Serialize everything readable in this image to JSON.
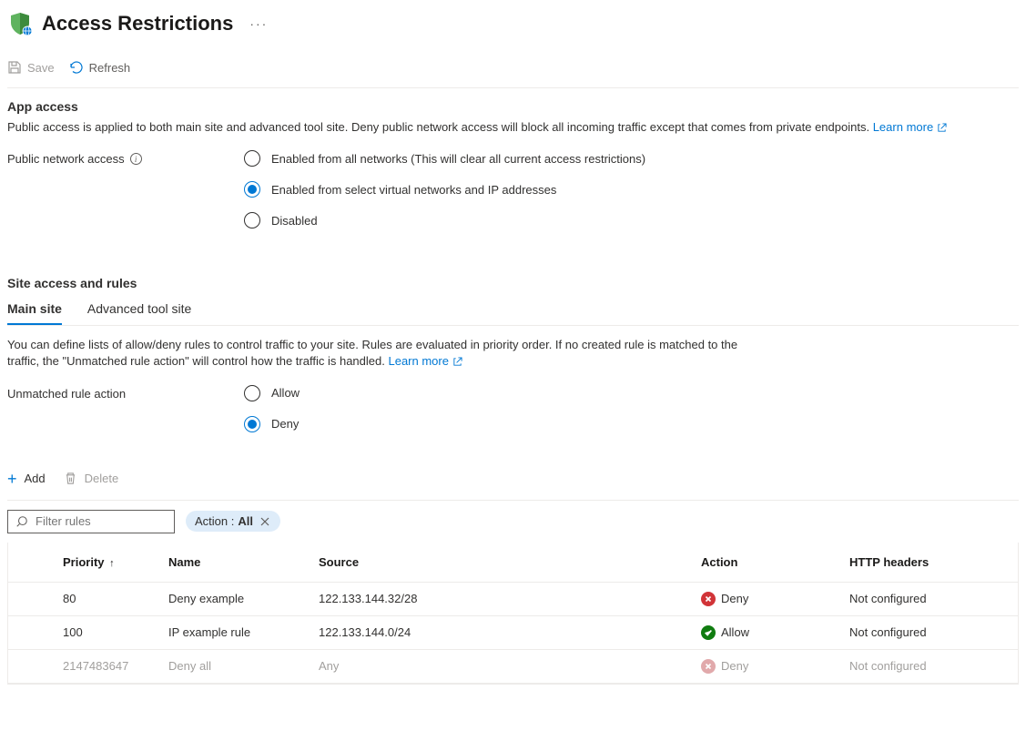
{
  "header": {
    "title": "Access Restrictions"
  },
  "toolbar": {
    "save_label": "Save",
    "refresh_label": "Refresh"
  },
  "app_access": {
    "title": "App access",
    "desc": "Public access is applied to both main site and advanced tool site. Deny public network access will block all incoming traffic except that comes from private endpoints.",
    "learn_more": "Learn more",
    "label": "Public network access",
    "options": [
      "Enabled from all networks (This will clear all current access restrictions)",
      "Enabled from select virtual networks and IP addresses",
      "Disabled"
    ],
    "selected": 1
  },
  "site_access": {
    "title": "Site access and rules",
    "tabs": [
      "Main site",
      "Advanced tool site"
    ],
    "active_tab": 0,
    "desc": "You can define lists of allow/deny rules to control traffic to your site. Rules are evaluated in priority order. If no created rule is matched to the traffic, the \"Unmatched rule action\" will control how the traffic is handled.",
    "learn_more": "Learn more",
    "unmatched_label": "Unmatched rule action",
    "unmatched_options": [
      "Allow",
      "Deny"
    ],
    "unmatched_selected": 1
  },
  "actions": {
    "add_label": "Add",
    "delete_label": "Delete"
  },
  "filter": {
    "placeholder": "Filter rules",
    "chip_key": "Action : ",
    "chip_value": "All"
  },
  "table": {
    "columns": [
      "Priority",
      "Name",
      "Source",
      "Action",
      "HTTP headers"
    ],
    "rows": [
      {
        "priority": "80",
        "name": "Deny example",
        "source": "122.133.144.32/28",
        "action": "Deny",
        "action_type": "deny",
        "headers": "Not configured",
        "disabled": false
      },
      {
        "priority": "100",
        "name": "IP example rule",
        "source": "122.133.144.0/24",
        "action": "Allow",
        "action_type": "allow",
        "headers": "Not configured",
        "disabled": false
      },
      {
        "priority": "2147483647",
        "name": "Deny all",
        "source": "Any",
        "action": "Deny",
        "action_type": "deny",
        "headers": "Not configured",
        "disabled": true
      }
    ]
  }
}
